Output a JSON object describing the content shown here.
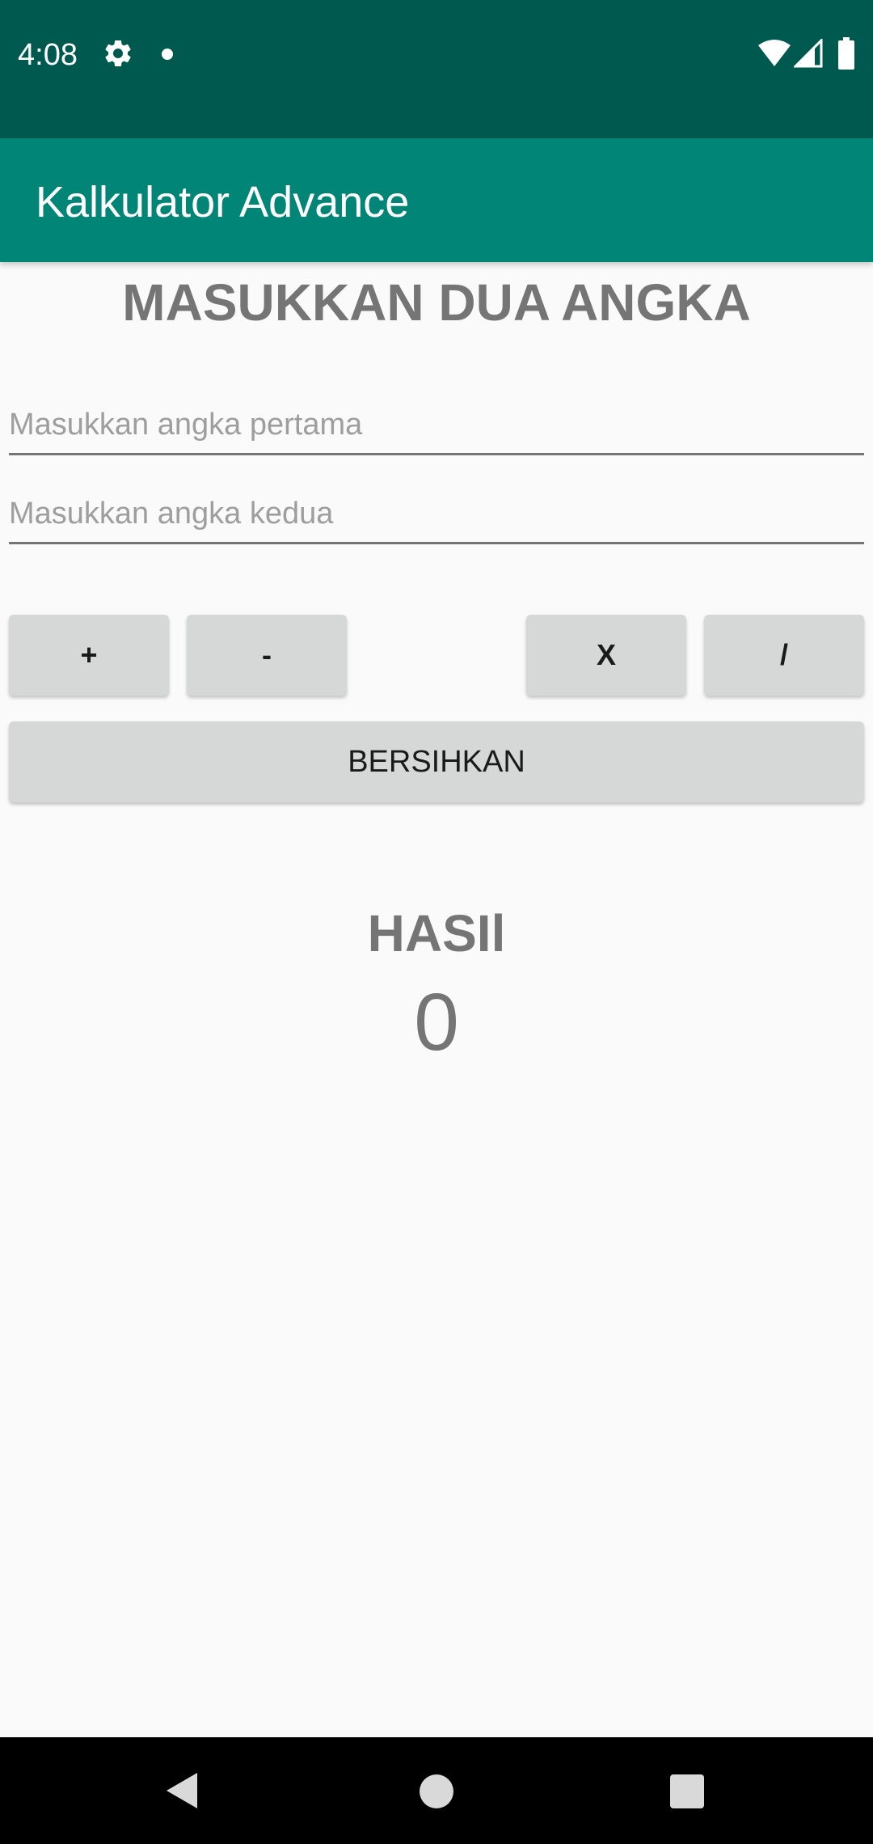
{
  "status_bar": {
    "time": "4:08",
    "icons": [
      "gear-icon",
      "notification-dot-icon",
      "wifi-icon",
      "signal-icon",
      "battery-icon"
    ]
  },
  "app_bar": {
    "title": "Kalkulator Advance",
    "color": "#008577"
  },
  "main": {
    "heading": "MASUKKAN DUA ANGKA",
    "first_input": {
      "placeholder": "Masukkan angka pertama",
      "value": ""
    },
    "second_input": {
      "placeholder": "Masukkan angka kedua",
      "value": ""
    },
    "buttons": {
      "add": "+",
      "subtract": "-",
      "multiply": "X",
      "divide": "/",
      "clear": "BERSIHKAN"
    },
    "result_label": "HASIl",
    "result_value": "0"
  },
  "nav_bar": {
    "icons": [
      "back-icon",
      "home-icon",
      "recent-apps-icon"
    ]
  },
  "colors": {
    "status_bar": "#00594e",
    "accent": "#008577",
    "button": "#d6d7d7",
    "text_gray": "#757575"
  }
}
